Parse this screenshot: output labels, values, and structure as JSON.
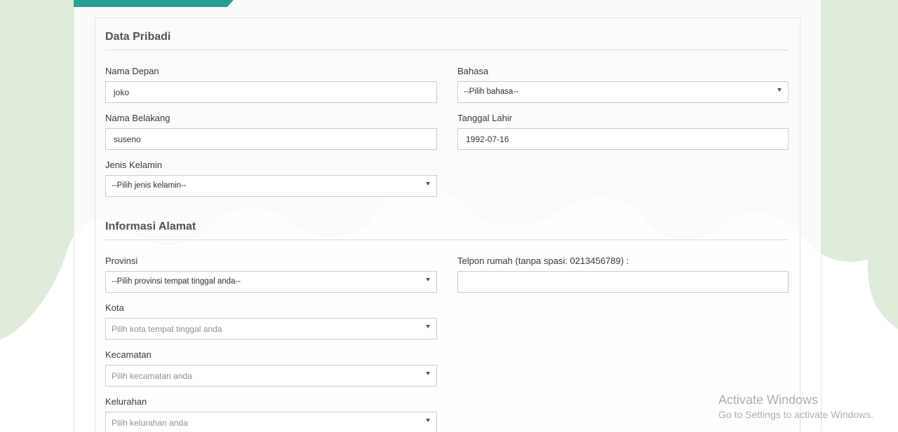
{
  "colors": {
    "accent": "#2a9d97",
    "background_blob": "#dfeadb"
  },
  "sections": {
    "personal_title": "Data Pribadi",
    "address_title": "Informasi Alamat"
  },
  "personal": {
    "first_name": {
      "label": "Nama Depan",
      "value": "joko"
    },
    "last_name": {
      "label": "Nama Belakang",
      "value": "suseno"
    },
    "gender": {
      "label": "Jenis Kelamin",
      "value": "--Pilih jenis kelamin--"
    },
    "language": {
      "label": "Bahasa",
      "value": "--Pilih bahasa--"
    },
    "birth_date": {
      "label": "Tanggal Lahir",
      "value": "1992-07-16"
    }
  },
  "address": {
    "province": {
      "label": "Provinsi",
      "value": "--Pilih provinsi tempat tinggal anda--"
    },
    "city": {
      "label": "Kota",
      "placeholder": "Pilih kota tempat tinggal anda"
    },
    "district": {
      "label": "Kecamatan",
      "placeholder": "Pilih kecamatan anda"
    },
    "village": {
      "label": "Kelurahan",
      "placeholder": "Pilih kelurahan anda"
    },
    "home_phone": {
      "label": "Telpon rumah (tanpa spasi: 0213456789) :",
      "value": ""
    }
  },
  "watermark": {
    "line1": "Activate Windows",
    "line2": "Go to Settings to activate Windows."
  },
  "icons": {
    "select_caret": "chevron-down-icon"
  }
}
